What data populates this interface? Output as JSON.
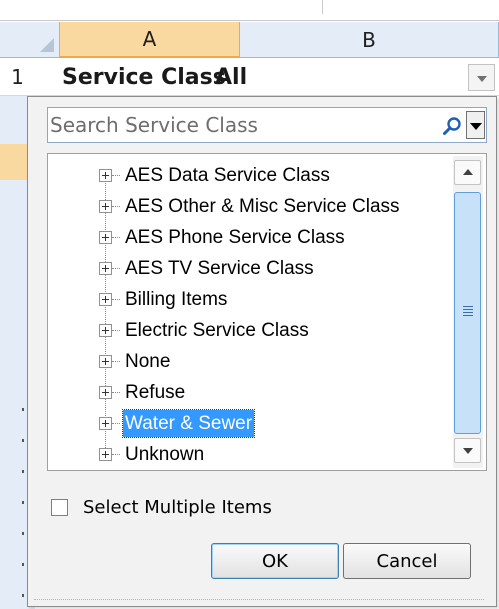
{
  "sheet": {
    "columns": [
      "A",
      "B"
    ],
    "row_number": "1",
    "cell_a1": "Service Class",
    "cell_b1": "All"
  },
  "filter_panel": {
    "search_placeholder": "Search Service Class",
    "items": [
      {
        "label": "AES Data Service Class",
        "selected": false
      },
      {
        "label": "AES Other & Misc Service Class",
        "selected": false
      },
      {
        "label": "AES Phone Service Class",
        "selected": false
      },
      {
        "label": "AES TV Service Class",
        "selected": false
      },
      {
        "label": "Billing Items",
        "selected": false
      },
      {
        "label": "Electric Service Class",
        "selected": false
      },
      {
        "label": "None",
        "selected": false
      },
      {
        "label": "Refuse",
        "selected": false
      },
      {
        "label": "Water & Sewer",
        "selected": true
      },
      {
        "label": "Unknown",
        "selected": false
      }
    ],
    "select_multiple_label": "Select Multiple Items",
    "select_multiple_checked": false,
    "ok_label": "OK",
    "cancel_label": "Cancel"
  },
  "colors": {
    "selected_highlight": "#3399ff",
    "active_column_header": "#f9d99f",
    "header_background": "#e4ecf7"
  },
  "icons": {
    "search": "magnifier-icon",
    "expander": "plus-box-icon"
  }
}
